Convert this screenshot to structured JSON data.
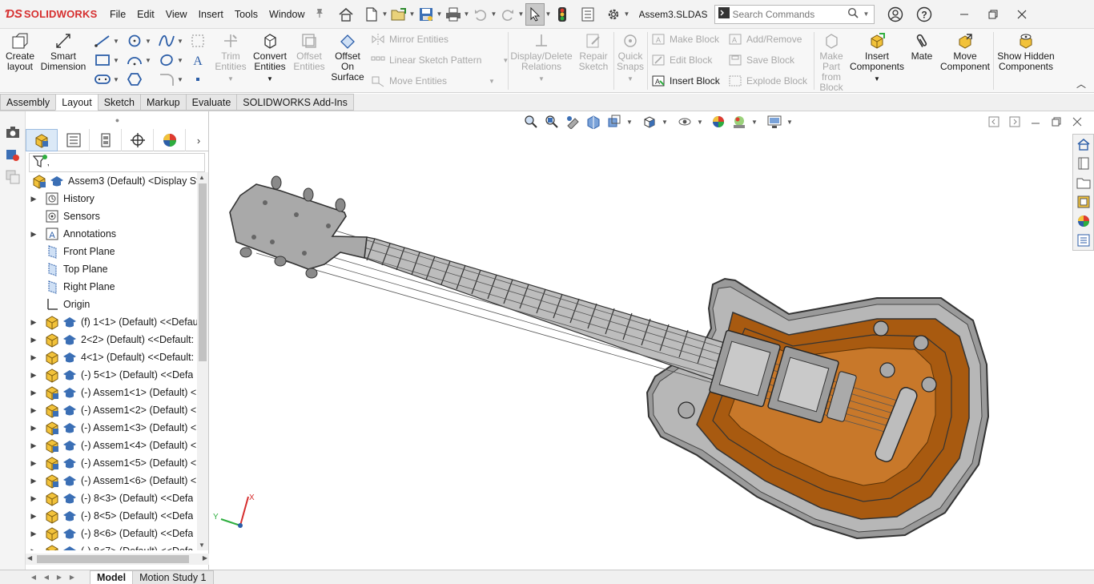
{
  "app": {
    "brand": "SOLIDWORKS",
    "document_title": "Assem3.SLDAS...",
    "menus": [
      "File",
      "Edit",
      "View",
      "Insert",
      "Tools",
      "Window"
    ],
    "search_placeholder": "Search Commands"
  },
  "ribbon": {
    "create_layout": "Create layout",
    "smart_dimension": "Smart Dimension",
    "trim_entities": "Trim Entities",
    "convert_entities": "Convert Entities",
    "offset_entities": "Offset Entities",
    "offset_on_surface": "Offset On Surface",
    "mirror_entities": "Mirror Entities",
    "linear_sketch_pattern": "Linear Sketch Pattern",
    "move_entities": "Move Entities",
    "display_delete_relations": "Display/Delete Relations",
    "repair_sketch": "Repair Sketch",
    "quick_snaps": "Quick Snaps",
    "make_block": "Make Block",
    "edit_block": "Edit Block",
    "insert_block": "Insert Block",
    "add_remove": "Add/Remove",
    "save_block": "Save Block",
    "explode_block": "Explode Block",
    "make_part_from_block": "Make Part from Block",
    "insert_components": "Insert Components",
    "mate": "Mate",
    "move_component": "Move Component",
    "show_hidden_components": "Show Hidden Components"
  },
  "tabs": [
    {
      "label": "Assembly",
      "active": false
    },
    {
      "label": "Layout",
      "active": true
    },
    {
      "label": "Sketch",
      "active": false
    },
    {
      "label": "Markup",
      "active": false
    },
    {
      "label": "Evaluate",
      "active": false
    },
    {
      "label": "SOLIDWORKS Add-Ins",
      "active": false
    }
  ],
  "tree": {
    "items": [
      {
        "label": "Assem3 (Default) <Display Stat",
        "kind": "root"
      },
      {
        "label": "History",
        "kind": "history"
      },
      {
        "label": "Sensors",
        "kind": "sensors"
      },
      {
        "label": "Annotations",
        "kind": "annotations"
      },
      {
        "label": "Front Plane",
        "kind": "plane"
      },
      {
        "label": "Top Plane",
        "kind": "plane"
      },
      {
        "label": "Right Plane",
        "kind": "plane"
      },
      {
        "label": "Origin",
        "kind": "origin"
      },
      {
        "label": "(f) 1<1> (Default) <<Defau",
        "kind": "part"
      },
      {
        "label": "2<2> (Default) <<Default:",
        "kind": "part"
      },
      {
        "label": "4<1> (Default) <<Default:",
        "kind": "part"
      },
      {
        "label": "(-) 5<1> (Default) <<Defa",
        "kind": "part"
      },
      {
        "label": "(-) Assem1<1> (Default) <",
        "kind": "subasm"
      },
      {
        "label": "(-) Assem1<2> (Default) <",
        "kind": "subasm"
      },
      {
        "label": "(-) Assem1<3> (Default) <",
        "kind": "subasm"
      },
      {
        "label": "(-) Assem1<4> (Default) <",
        "kind": "subasm"
      },
      {
        "label": "(-) Assem1<5> (Default) <",
        "kind": "subasm"
      },
      {
        "label": "(-) Assem1<6> (Default) <",
        "kind": "subasm"
      },
      {
        "label": "(-) 8<3> (Default) <<Defa",
        "kind": "part"
      },
      {
        "label": "(-) 8<5> (Default) <<Defa",
        "kind": "part"
      },
      {
        "label": "(-) 8<6> (Default) <<Defa",
        "kind": "part"
      },
      {
        "label": "(-) 8<7> (Default) <<Defa",
        "kind": "part"
      }
    ]
  },
  "bottom_tabs": [
    {
      "label": "Model",
      "active": true
    },
    {
      "label": "Motion Study 1",
      "active": false
    }
  ],
  "triad": {
    "x": "X",
    "y": "Y"
  },
  "model": {
    "body_color": "#a85a10",
    "rim_color": "#9a9a9a"
  }
}
